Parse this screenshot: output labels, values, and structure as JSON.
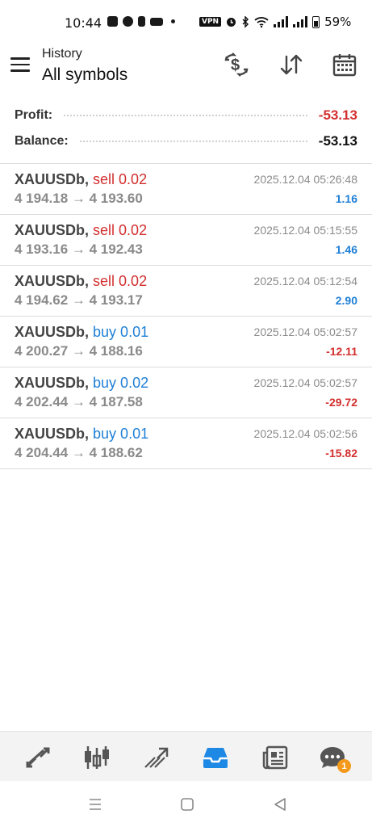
{
  "status_bar": {
    "time": "10:44",
    "vpn": "VPN",
    "battery": "59%"
  },
  "header": {
    "subtitle": "History",
    "title": "All symbols"
  },
  "summary": {
    "profit_label": "Profit:",
    "profit_value": "-53.13",
    "balance_label": "Balance:",
    "balance_value": "-53.13"
  },
  "colors": {
    "sell": "#d32f2f",
    "buy": "#1e7fd6",
    "positive": "#1e7fd6",
    "negative": "#d32f2f",
    "active_nav": "#1e88e5",
    "badge": "#f39a1c"
  },
  "trades": [
    {
      "symbol": "XAUUSDb,",
      "side": "sell 0.02",
      "side_type": "sell",
      "prices": "4 194.18 → 4 193.60",
      "time": "2025.12.04 05:26:48",
      "profit": "1.16",
      "profit_type": "positive"
    },
    {
      "symbol": "XAUUSDb,",
      "side": "sell 0.02",
      "side_type": "sell",
      "prices": "4 193.16 → 4 192.43",
      "time": "2025.12.04 05:15:55",
      "profit": "1.46",
      "profit_type": "positive"
    },
    {
      "symbol": "XAUUSDb,",
      "side": "sell 0.02",
      "side_type": "sell",
      "prices": "4 194.62 → 4 193.17",
      "time": "2025.12.04 05:12:54",
      "profit": "2.90",
      "profit_type": "positive"
    },
    {
      "symbol": "XAUUSDb,",
      "side": "buy 0.01",
      "side_type": "buy",
      "prices": "4 200.27 → 4 188.16",
      "time": "2025.12.04 05:02:57",
      "profit": "-12.11",
      "profit_type": "negative"
    },
    {
      "symbol": "XAUUSDb,",
      "side": "buy 0.02",
      "side_type": "buy",
      "prices": "4 202.44 → 4 187.58",
      "time": "2025.12.04 05:02:57",
      "profit": "-29.72",
      "profit_type": "negative"
    },
    {
      "symbol": "XAUUSDb,",
      "side": "buy 0.01",
      "side_type": "buy",
      "prices": "4 204.44 → 4 188.62",
      "time": "2025.12.04 05:02:56",
      "profit": "-15.82",
      "profit_type": "negative"
    }
  ],
  "bottom_nav": {
    "items": [
      "quotes-icon",
      "chart-icon",
      "trade-icon",
      "history-icon",
      "news-icon",
      "chat-icon"
    ],
    "active": "history-icon",
    "chat_badge": "1"
  }
}
